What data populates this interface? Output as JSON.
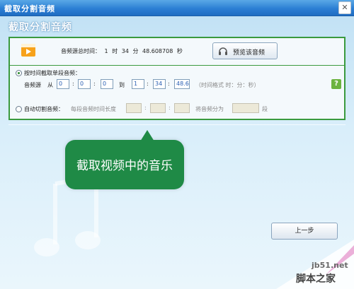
{
  "window": {
    "title": "截取分割音频"
  },
  "header": {
    "title": "截取分割音频"
  },
  "duration": {
    "label": "音频源总时间：",
    "hours": "1",
    "hour_unit": "时",
    "minutes": "34",
    "minute_unit": "分",
    "seconds": "48.608708",
    "second_unit": "秒"
  },
  "preview": {
    "label": "预览该音频"
  },
  "by_time": {
    "label": "按时间截取单段音频：",
    "source_label": "音频源",
    "from_label": "从",
    "to_label": "到",
    "sep": ":",
    "from": [
      "0",
      "0",
      "0"
    ],
    "to": [
      "1",
      "34",
      "48.6"
    ],
    "hint": "（时间格式 时：分：秒）"
  },
  "auto_cut": {
    "label": "自动切割音频：",
    "segment_label": "每段音频时间长度",
    "split_label": "将音频分为",
    "segment_unit": "段"
  },
  "callout": {
    "text": "截取视频中的音乐"
  },
  "buttons": {
    "prev": "上一步"
  },
  "watermark": {
    "site": "jb51.net",
    "cn": "脚本之家"
  },
  "colors": {
    "accent_green": "#3a9a3e",
    "bubble": "#1f8a46",
    "titlebar": "#2c7fd4"
  }
}
